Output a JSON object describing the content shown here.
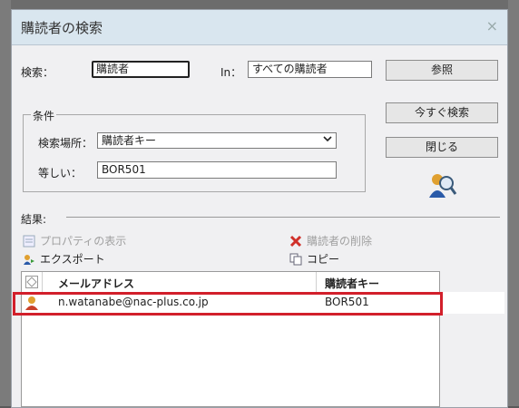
{
  "dialog": {
    "title": "購読者の検索",
    "close_glyph": "×"
  },
  "search": {
    "search_label": "検索：",
    "search_value": "購読者",
    "in_label": "In：",
    "in_value": "すべての購読者"
  },
  "buttons": {
    "browse": "参照",
    "search_now": "今すぐ検索",
    "close": "閉じる"
  },
  "conditions": {
    "group_title": "条件",
    "location_label": "検索場所：",
    "location_value": "購読者キー",
    "equals_label": "等しい：",
    "equals_value": "BOR501"
  },
  "results": {
    "label": "結果:",
    "actions": {
      "properties": "プロパティの表示",
      "delete": "購読者の削除",
      "export": "エクスポート",
      "copy": "コピー"
    },
    "columns": [
      "メールアドレス",
      "購読者キー"
    ],
    "rows": [
      {
        "email": "n.watanabe@nac-plus.co.jp",
        "key": "BOR501"
      }
    ]
  },
  "icons": {
    "subscriber_search": "subscriber-search-icon",
    "row": "subscriber-icon"
  },
  "colors": {
    "highlight": "#d21f2b",
    "titlebar": "#d9e6ef"
  }
}
